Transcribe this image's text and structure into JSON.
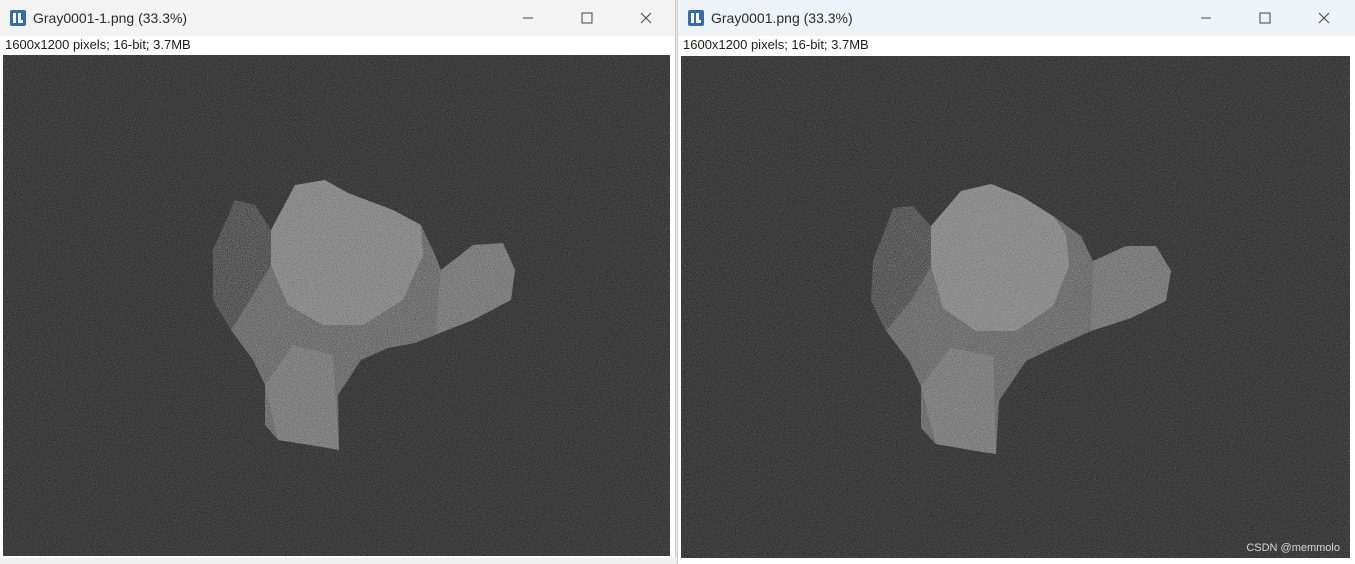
{
  "windows": [
    {
      "title": "Gray0001-1.png (33.3%)",
      "info": "1600x1200 pixels; 16-bit; 3.7MB",
      "icon": "imagej-icon",
      "controls": [
        "minimize-icon",
        "maximize-icon",
        "close-icon"
      ]
    },
    {
      "title": "Gray0001.png (33.3%)",
      "info": "1600x1200 pixels; 16-bit; 3.7MB",
      "icon": "imagej-icon",
      "controls": [
        "minimize-icon",
        "maximize-icon",
        "close-icon"
      ],
      "watermark": "CSDN @memmolo"
    }
  ],
  "colors": {
    "image_background": "#1c1c1c",
    "titlebar_inactive": "#f3f3f3",
    "titlebar_active": "#eef3f8",
    "icon_accent": "#2f6db5"
  }
}
